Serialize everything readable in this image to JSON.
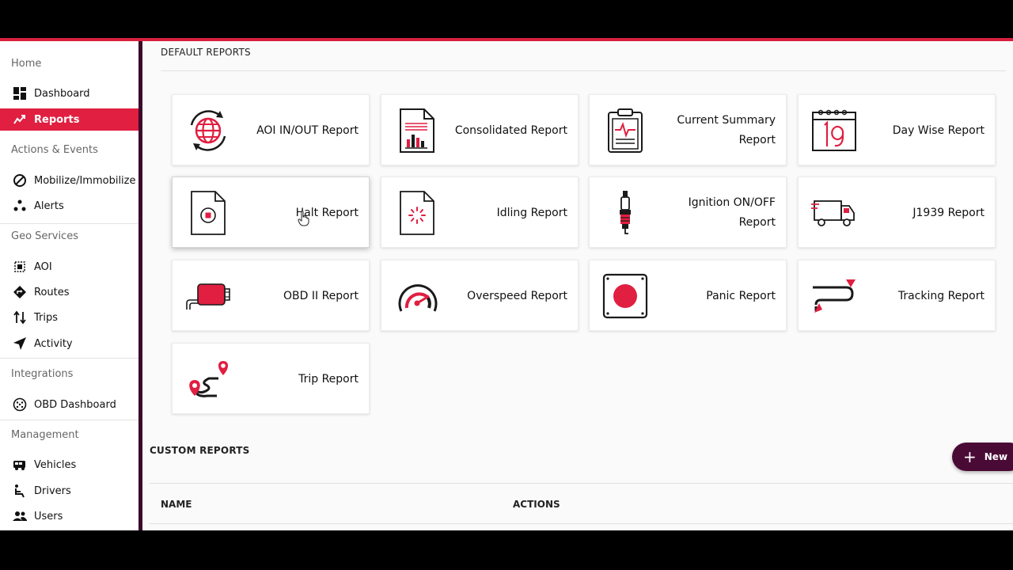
{
  "sidebar": {
    "sections": {
      "home": "Home",
      "actions": "Actions & Events",
      "geo": "Geo Services",
      "integrations": "Integrations",
      "management": "Management"
    },
    "items": {
      "dashboard": "Dashboard",
      "reports": "Reports",
      "mobilize": "Mobilize/Immobilize",
      "alerts": "Alerts",
      "aoi": "AOI",
      "routes": "Routes",
      "trips": "Trips",
      "activity": "Activity",
      "obd_dashboard": "OBD Dashboard",
      "vehicles": "Vehicles",
      "drivers": "Drivers",
      "users": "Users"
    }
  },
  "main": {
    "default_heading": "DEFAULT REPORTS",
    "custom_heading": "CUSTOM REPORTS",
    "new_button": "New",
    "table_headers": {
      "name": "NAME",
      "actions": "ACTIONS"
    },
    "reports": [
      {
        "label": "AOI IN/OUT Report",
        "icon": "globe-refresh-icon"
      },
      {
        "label": "Consolidated Report",
        "icon": "bar-chart-document-icon"
      },
      {
        "label": "Current Summary Report",
        "icon": "clipboard-pulse-icon"
      },
      {
        "label": "Day Wise Report",
        "icon": "calendar-icon"
      },
      {
        "label": "Halt Report",
        "icon": "stop-document-icon"
      },
      {
        "label": "Idling Report",
        "icon": "spinner-document-icon"
      },
      {
        "label": "Ignition ON/OFF Report",
        "icon": "spark-plug-icon"
      },
      {
        "label": "J1939 Report",
        "icon": "truck-icon"
      },
      {
        "label": "OBD II Report",
        "icon": "obd-connector-icon"
      },
      {
        "label": "Overspeed Report",
        "icon": "speedometer-icon"
      },
      {
        "label": "Panic Report",
        "icon": "panic-button-icon"
      },
      {
        "label": "Tracking Report",
        "icon": "route-arrow-icon"
      },
      {
        "label": "Trip Report",
        "icon": "trip-pins-icon"
      }
    ]
  },
  "colors": {
    "accent": "#e01f41",
    "dark": "#4a0a36",
    "sidebar_border": "#3b0a2a"
  }
}
